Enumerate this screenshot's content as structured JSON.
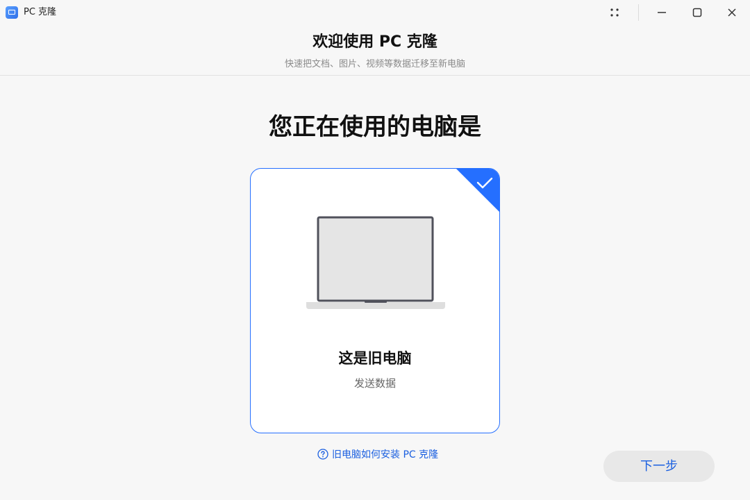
{
  "titlebar": {
    "app_title": "PC 克隆"
  },
  "header": {
    "title": "欢迎使用 PC 克隆",
    "subtitle": "快速把文档、图片、视频等数据迁移至新电脑"
  },
  "main": {
    "question": "您正在使用的电脑是",
    "card": {
      "title": "这是旧电脑",
      "subtitle": "发送数据",
      "selected": true,
      "accent_color": "#256fff"
    },
    "help_link": "旧电脑如何安装 PC 克隆",
    "next_button": "下一步"
  }
}
